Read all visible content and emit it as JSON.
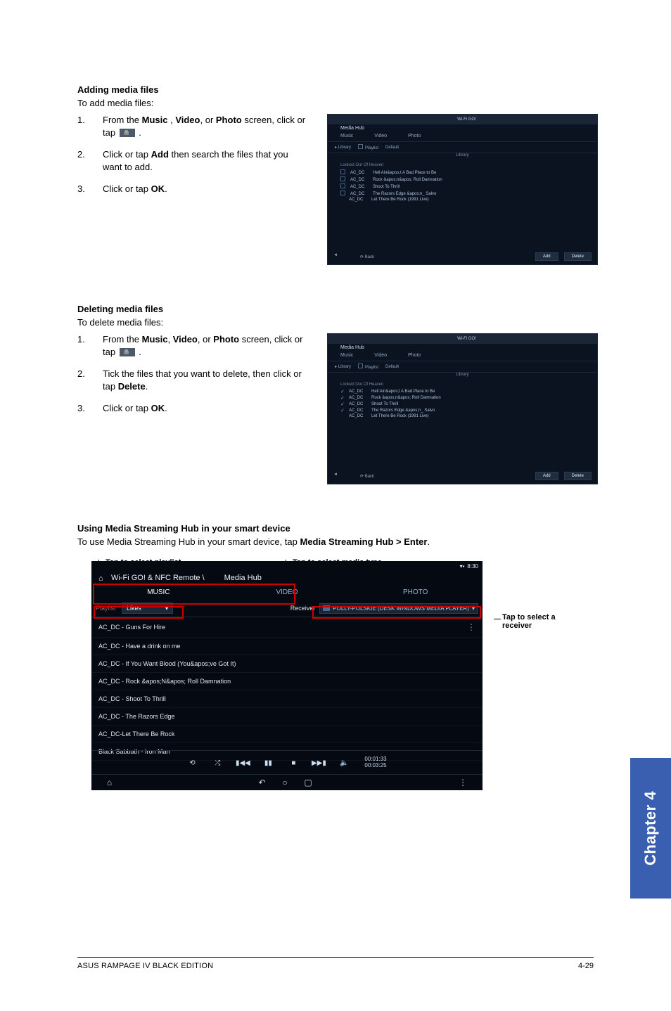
{
  "section1": {
    "heading": "Adding media files",
    "intro": "To add media files:",
    "steps": [
      {
        "num": "1.",
        "pre": "From the ",
        "b1": "Music",
        "mid1": " , ",
        "b2": "Video",
        "mid2": ", or ",
        "b3": "Photo",
        "post": " screen, click or tap ",
        "icon": true,
        "tail": " ."
      },
      {
        "num": "2.",
        "pre": "Click or tap ",
        "b1": "Add",
        "post": " then search the files that you want to add."
      },
      {
        "num": "3.",
        "pre": "Click or tap ",
        "b1": "OK",
        "post": "."
      }
    ]
  },
  "section2": {
    "heading": "Deleting media files",
    "intro": "To delete media files:",
    "steps": [
      {
        "num": "1.",
        "pre": "From the ",
        "b1": "Music",
        "mid1": ", ",
        "b2": "Video",
        "mid2": ", or ",
        "b3": "Photo",
        "post": " screen, click or tap ",
        "icon": true,
        "tail": " ."
      },
      {
        "num": "2.",
        "pre": "Tick the files that you want to delete, then click or tap ",
        "b1": "Delete",
        "post": "."
      },
      {
        "num": "3.",
        "pre": "Click or tap ",
        "b1": "OK",
        "post": "."
      }
    ]
  },
  "section3": {
    "heading": "Using Media Streaming Hub in your smart device",
    "intro_pre": "To use Media Streaming Hub in your smart device, tap ",
    "intro_bold": "Media Streaming Hub > Enter",
    "intro_post": "."
  },
  "app_shot": {
    "title": "Wi-Fi GO!",
    "subtitle": "Media Hub",
    "tabs": [
      "Music",
      "Video",
      "Photo"
    ],
    "tool_library": "Library",
    "tool_playlist": "Playlist",
    "tool_default": "Default",
    "list_header": "Library",
    "list_sub": "Looked Out Of Heaven",
    "rows": [
      {
        "c2": "AC_DC",
        "c3": "Hell Ain&apos;t A Bad Place to Be"
      },
      {
        "c2": "AC_DC",
        "c3": "Rock &apos;n&apos; Roll Damnation"
      },
      {
        "c2": "AC_DC",
        "c3": "Shoot To Thrill"
      },
      {
        "c2": "AC_DC",
        "c3": "The Razors Edge &apos;n_ Salvo"
      },
      {
        "c2": "AC_DC",
        "c3": "Let There Be Rock (1991 Live)"
      }
    ],
    "btn_add": "Add",
    "btn_delete": "Delete"
  },
  "phone": {
    "status_time": "8:30",
    "top_title": "Wi-Fi GO! & NFC Remote \\",
    "top_title2": "Media Hub",
    "tabs": [
      "Music",
      "Video",
      "Photo"
    ],
    "playlist_label": "Playlist",
    "playlist_value": "Likes",
    "receiver_label": "Receiver",
    "receiver_value": "POLLY-POLSKIE (DESK WINDOWS MEDIA PLAYER)",
    "tracks": [
      "AC_DC - Guns For Hire",
      "AC_DC - Have a drink on me",
      "AC_DC - If You Want Blood (You&apos;ve Got It)",
      "AC_DC - Rock &apos;N&apos; Roll Damnation",
      "AC_DC - Shoot To Thrill",
      "AC_DC - The Razors Edge",
      "AC_DC-Let There Be Rock",
      "Black Sabbath - Iron Man"
    ],
    "time_elapsed": "00:01:33",
    "time_total": "00:03:25"
  },
  "annotations": {
    "playlist": "Tap to select playlist",
    "mediatype": "Tap to select media type",
    "receiver": "Tap to select a receiver"
  },
  "footer": {
    "left": "ASUS RAMPAGE IV BLACK EDITION",
    "right": "4-29"
  },
  "chapter": "Chapter 4"
}
